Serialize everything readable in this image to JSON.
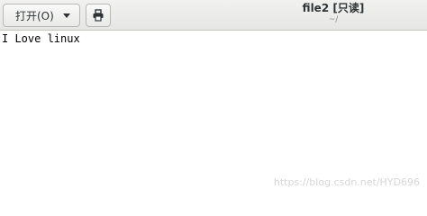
{
  "toolbar": {
    "open_label": "打开(O)",
    "open_icon": "chevron-down-icon",
    "print_icon": "printer-icon"
  },
  "header": {
    "title": "file2 [只读]",
    "subtitle": "~/"
  },
  "editor": {
    "lines": [
      "I Love linux"
    ]
  },
  "watermark": "https://blog.csdn.net/HYD696"
}
